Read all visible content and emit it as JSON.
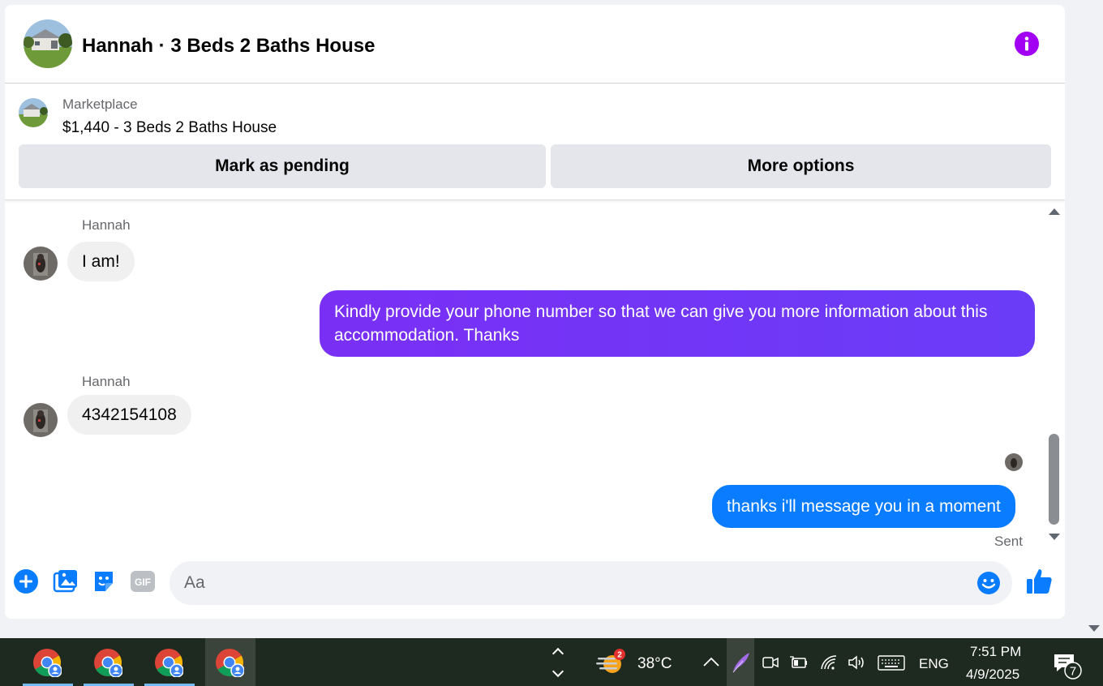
{
  "header": {
    "title": "Hannah · 3 Beds 2 Baths House",
    "info_icon": "info-icon"
  },
  "marketplace": {
    "label": "Marketplace",
    "listing_title": "$1,440 - 3 Beds 2 Baths House",
    "mark_pending_label": "Mark as pending",
    "more_options_label": "More options"
  },
  "messages": [
    {
      "sender": "Hannah",
      "text": "I am!"
    },
    {
      "sender": "me",
      "text": "Kindly provide your phone number so that we can give you more information about this accommodation. Thanks"
    },
    {
      "sender": "Hannah",
      "text": "4342154108"
    },
    {
      "sender": "me",
      "text": "thanks i'll message you in a moment"
    }
  ],
  "sent_status": "Sent",
  "composer": {
    "placeholder": "Aa",
    "gif_label": "GIF"
  },
  "taskbar": {
    "weather_badge": "2",
    "temperature": "38°C",
    "language": "ENG",
    "time": "7:51 PM",
    "date": "4/9/2025",
    "notifications_count": "7"
  },
  "colors": {
    "accent_purple": "#7a2ff5",
    "accent_blue": "#0a7cff",
    "info_purple": "#a100f2"
  }
}
